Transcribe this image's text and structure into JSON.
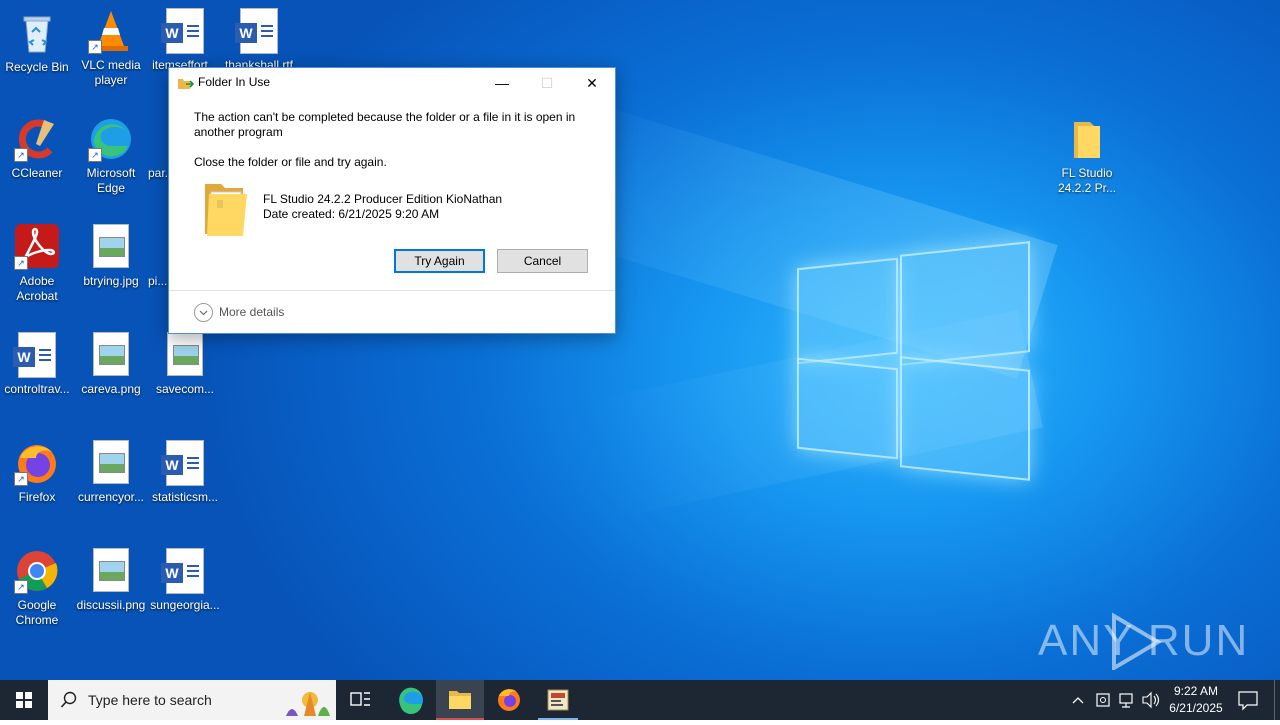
{
  "desktop": {
    "icons": [
      {
        "label": "Recycle Bin"
      },
      {
        "label": "VLC media player"
      },
      {
        "label": "itemseffort..."
      },
      {
        "label": "thankshall.rtf"
      },
      {
        "label": "CCleaner"
      },
      {
        "label": "Microsoft Edge"
      },
      {
        "label": "par..."
      },
      {
        "label": "Adobe Acrobat"
      },
      {
        "label": "btrying.jpg"
      },
      {
        "label": "pi..."
      },
      {
        "label": "controltrav..."
      },
      {
        "label": "careva.png"
      },
      {
        "label": "savecom..."
      },
      {
        "label": "Firefox"
      },
      {
        "label": "currencyor..."
      },
      {
        "label": "statisticsm..."
      },
      {
        "label": "Google Chrome"
      },
      {
        "label": "discussii.png"
      },
      {
        "label": "sungeorgia..."
      },
      {
        "label": "FL Studio 24.2.2 Pr..."
      }
    ],
    "watermark": "ANY RUN"
  },
  "dialog": {
    "title": "Folder In Use",
    "message": "The action can't be completed because the folder or a file in it is open in another program",
    "instruction": "Close the folder or file and try again.",
    "item_name": "FL Studio 24.2.2 Producer Edition KioNathan",
    "item_date": "Date created: 6/21/2025 9:20 AM",
    "try_again": "Try Again",
    "cancel": "Cancel",
    "more_details": "More details"
  },
  "taskbar": {
    "search_placeholder": "Type here to search",
    "time": "9:22 AM",
    "date": "6/21/2025"
  }
}
